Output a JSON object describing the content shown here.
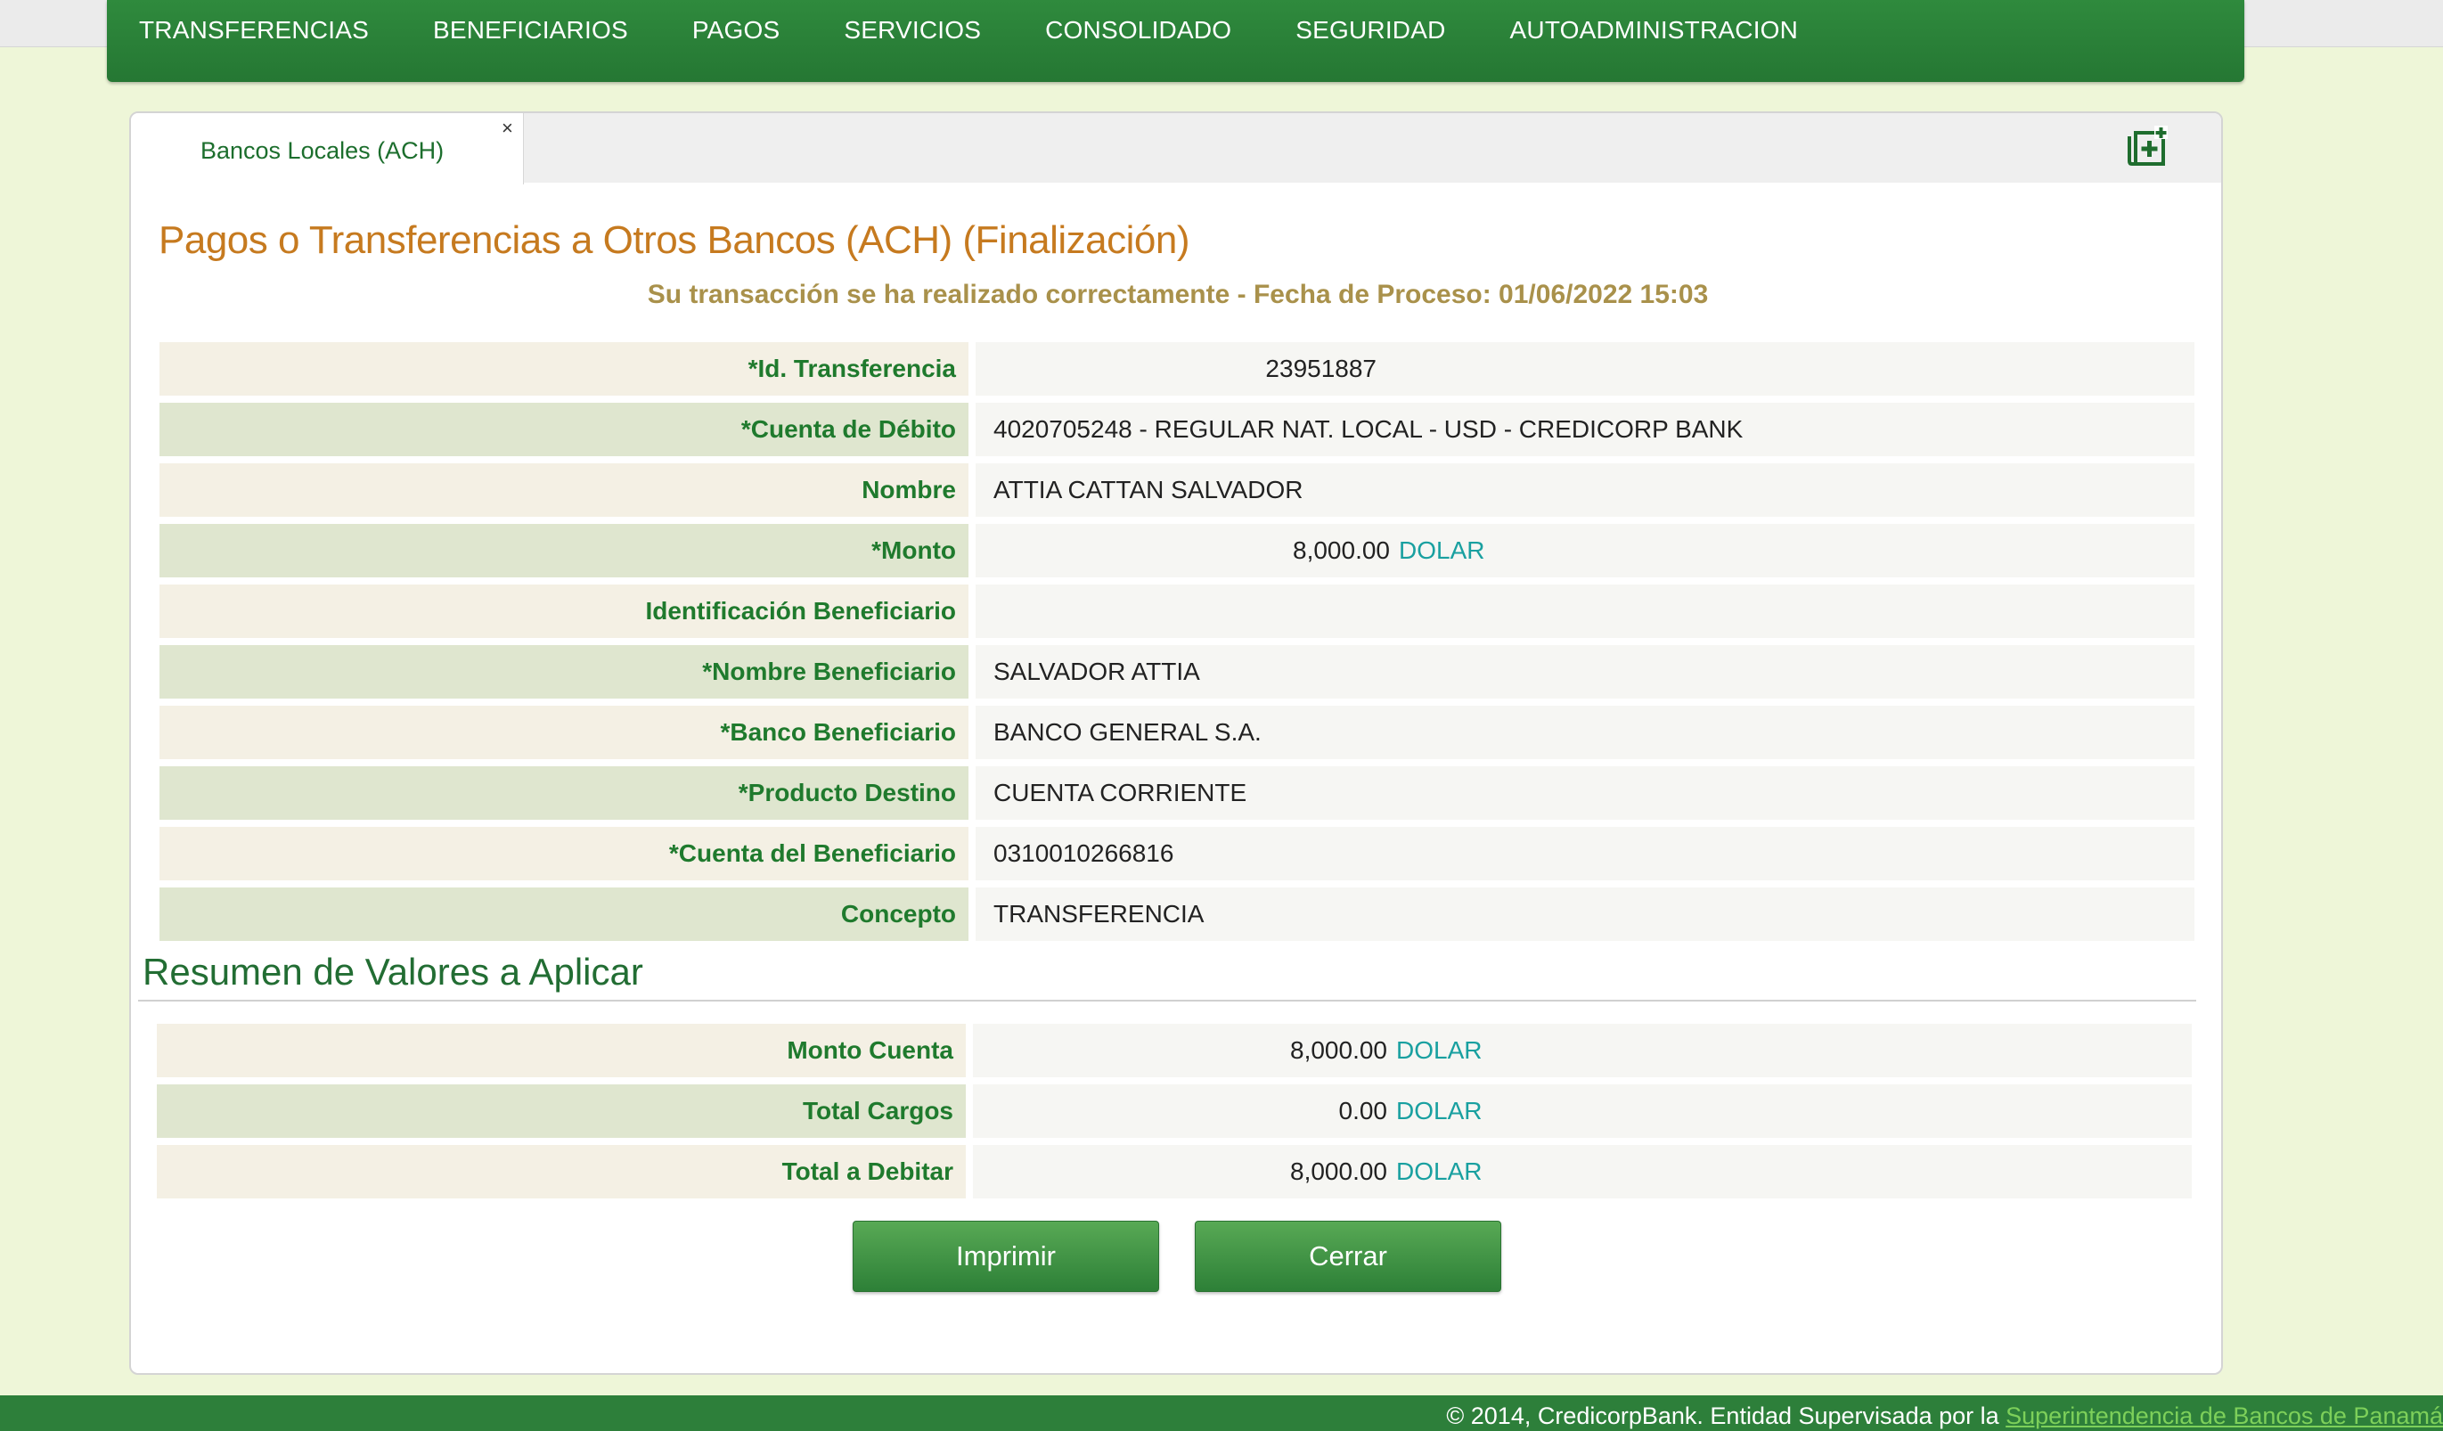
{
  "nav": {
    "items": [
      "TRANSFERENCIAS",
      "BENEFICIARIOS",
      "PAGOS",
      "SERVICIOS",
      "CONSOLIDADO",
      "SEGURIDAD",
      "AUTOADMINISTRACION"
    ]
  },
  "tab": {
    "label": "Bancos Locales (ACH)",
    "close": "×",
    "add_icon": "add-tab-icon"
  },
  "page": {
    "title": "Pagos o Transferencias a Otros Bancos (ACH) (Finalización)",
    "success_message": "Su transacción se ha realizado correctamente - Fecha de Proceso: 01/06/2022 15:03"
  },
  "details": {
    "id_transferencia": {
      "label": "*Id. Transferencia",
      "value": "23951887"
    },
    "cuenta_debito": {
      "label": "*Cuenta de Débito",
      "value": "4020705248 - REGULAR NAT. LOCAL - USD - CREDICORP BANK"
    },
    "nombre": {
      "label": "Nombre",
      "value": "ATTIA CATTAN SALVADOR"
    },
    "monto": {
      "label": "*Monto",
      "value": "8,000.00",
      "currency": "DOLAR"
    },
    "identificacion_beneficiario": {
      "label": "Identificación Beneficiario",
      "value": ""
    },
    "nombre_beneficiario": {
      "label": "*Nombre Beneficiario",
      "value": "SALVADOR ATTIA"
    },
    "banco_beneficiario": {
      "label": "*Banco Beneficiario",
      "value": "BANCO GENERAL S.A."
    },
    "producto_destino": {
      "label": "*Producto Destino",
      "value": "CUENTA CORRIENTE"
    },
    "cuenta_beneficiario": {
      "label": "*Cuenta del Beneficiario",
      "value": "0310010266816"
    },
    "concepto": {
      "label": "Concepto",
      "value": "TRANSFERENCIA"
    }
  },
  "summary": {
    "title": "Resumen de Valores a Aplicar",
    "monto_cuenta": {
      "label": "Monto Cuenta",
      "value": "8,000.00",
      "currency": "DOLAR"
    },
    "total_cargos": {
      "label": "Total Cargos",
      "value": "0.00",
      "currency": "DOLAR"
    },
    "total_debitar": {
      "label": "Total a Debitar",
      "value": "8,000.00",
      "currency": "DOLAR"
    }
  },
  "buttons": {
    "print": "Imprimir",
    "close": "Cerrar"
  },
  "footer": {
    "text": "© 2014, CredicorpBank. Entidad Supervisada por la ",
    "link": "Superintendencia de Bancos de Panamá"
  },
  "colors": {
    "brand_green": "#2d7f3a",
    "title_orange": "#c67a1f",
    "success_gold": "#a9914b",
    "currency_teal": "#19a0a0"
  }
}
